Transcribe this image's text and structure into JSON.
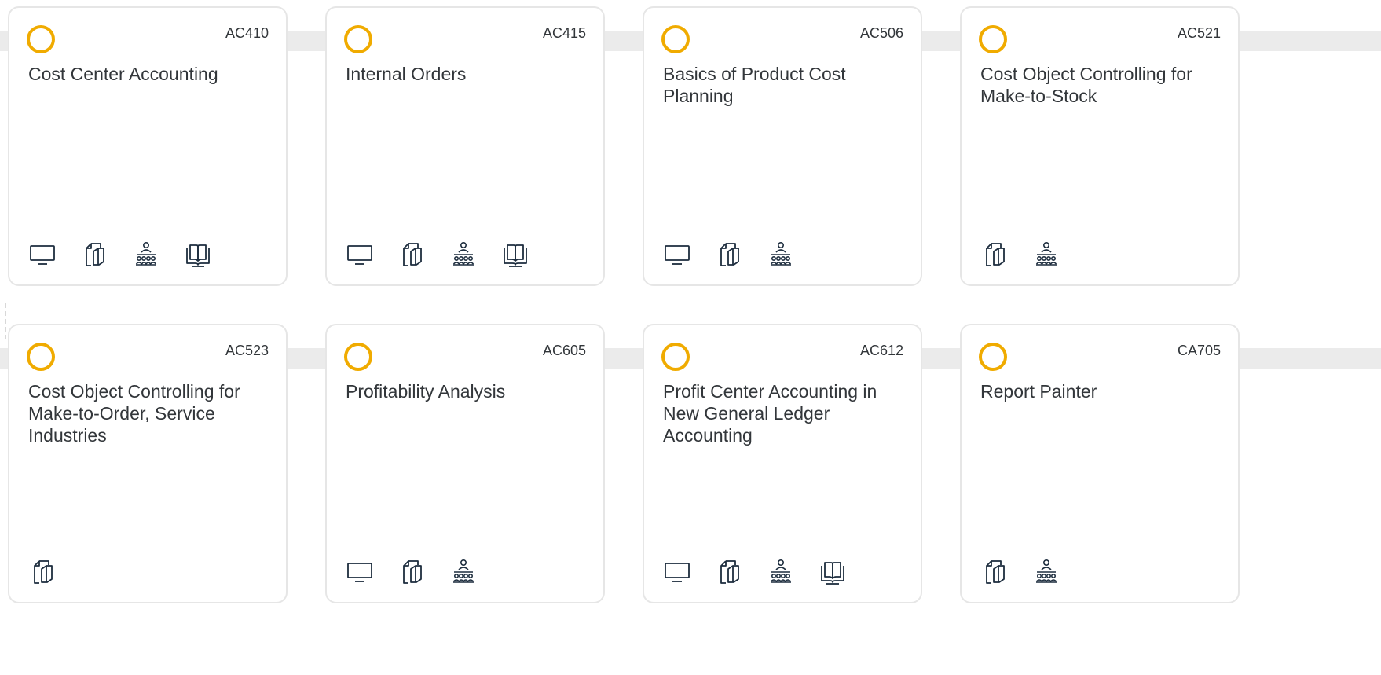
{
  "icons": {
    "elearning": "monitor-icon",
    "handbook": "document-copy-icon",
    "classroom": "classroom-icon",
    "ebook": "open-book-icon"
  },
  "accent_color": "#f0ab00",
  "rows": [
    {
      "cards": [
        {
          "code": "AC410",
          "title": "Cost Center Accounting",
          "icons": [
            "monitor",
            "document",
            "classroom",
            "book"
          ]
        },
        {
          "code": "AC415",
          "title": "Internal Orders",
          "icons": [
            "monitor",
            "document",
            "classroom",
            "book"
          ]
        },
        {
          "code": "AC506",
          "title": "Basics of Product Cost Planning",
          "icons": [
            "monitor",
            "document",
            "classroom"
          ]
        },
        {
          "code": "AC521",
          "title": "Cost Object Controlling for Make-to-Stock",
          "icons": [
            "document",
            "classroom"
          ]
        }
      ]
    },
    {
      "cards": [
        {
          "code": "AC523",
          "title": "Cost Object Controlling for Make-to-Order, Service Industries",
          "icons": [
            "document"
          ]
        },
        {
          "code": "AC605",
          "title": "Profitability Analysis",
          "icons": [
            "monitor",
            "document",
            "classroom"
          ]
        },
        {
          "code": "AC612",
          "title": "Profit Center Accounting in New General Ledger Accounting",
          "icons": [
            "monitor",
            "document",
            "classroom",
            "book"
          ]
        },
        {
          "code": "CA705",
          "title": "Report Painter",
          "icons": [
            "document",
            "classroom"
          ]
        }
      ]
    }
  ]
}
